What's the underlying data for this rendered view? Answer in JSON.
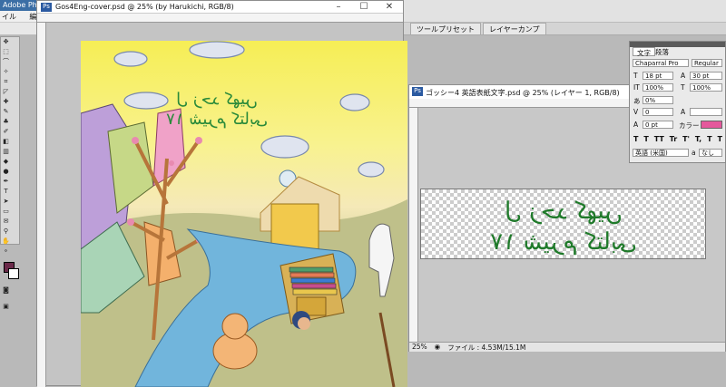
{
  "app": {
    "title": "Adobe Pho",
    "menu": [
      "イル(F)",
      "編集"
    ]
  },
  "doc1": {
    "title": "Gos4Eng-cover.psd @ 25% (by Harukichi, RGB/8)",
    "artwork_text_1": "ل زحد کھیں",
    "artwork_text_2": "١٧ شیرم کتابی"
  },
  "panel_strip": {
    "tabs": [
      "ツールプリセット",
      "レイヤーカンプ"
    ]
  },
  "doc2": {
    "title": "ゴッシー4 英語表紙文字.psd @ 25% (レイヤー 1, RGB/8)",
    "zoom": "25%",
    "file_info": "ファイル : 4.53M/15.1M",
    "text_line_1": "ل زحد کھیں",
    "text_line_2": "١٧ شیرم کتابی"
  },
  "character_panel": {
    "tabs": [
      "文字",
      "段落"
    ],
    "font_family": "Chaparral Pro",
    "font_style": "Regular",
    "size": "18 pt",
    "leading": "30 pt",
    "vscale": "100%",
    "hscale": "100%",
    "tracking": "0%",
    "kerning": "0",
    "baseline": "0 pt",
    "color_label": "カラー :",
    "language": "英語 (米国)",
    "aa": "なし",
    "color_swatch": "#e4589c",
    "format_buttons": [
      "T",
      "T",
      "TT",
      "Tr",
      "T'",
      "T,",
      "T",
      "T"
    ]
  }
}
